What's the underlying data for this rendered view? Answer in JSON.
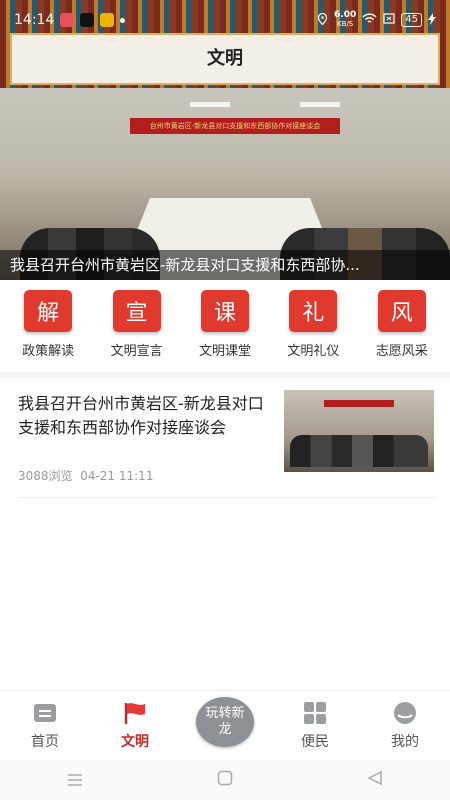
{
  "status_bar": {
    "time": "14:14",
    "net_speed": "6.00",
    "net_unit": "KB/S",
    "battery": "45"
  },
  "header": {
    "title": "文明"
  },
  "hero": {
    "banner_text": "台州市黄岩区-新龙县对口支援和东西部协作对接座谈会",
    "caption": "我县召开台州市黄岩区-新龙县对口支援和东西部协..."
  },
  "categories": [
    {
      "icon_char": "解",
      "label": "政策解读"
    },
    {
      "icon_char": "宣",
      "label": "文明宣言"
    },
    {
      "icon_char": "课",
      "label": "文明课堂"
    },
    {
      "icon_char": "礼",
      "label": "文明礼仪"
    },
    {
      "icon_char": "风",
      "label": "志愿风采"
    }
  ],
  "news": [
    {
      "title": "我县召开台州市黄岩区-新龙县对口支援和东西部协作对接座谈会",
      "views": "3088浏览",
      "date": "04-21 11:11"
    }
  ],
  "bottom_nav": {
    "items": [
      {
        "label": "首页",
        "icon": "home-icon"
      },
      {
        "label": "文明",
        "icon": "flag-icon"
      },
      {
        "label": "玩转新龙",
        "icon": "center-button"
      },
      {
        "label": "便民",
        "icon": "grid-icon"
      },
      {
        "label": "我的",
        "icon": "profile-icon"
      }
    ],
    "active": "文明"
  },
  "colors": {
    "accent": "#c62828",
    "category_bg": "#e03a2e"
  }
}
